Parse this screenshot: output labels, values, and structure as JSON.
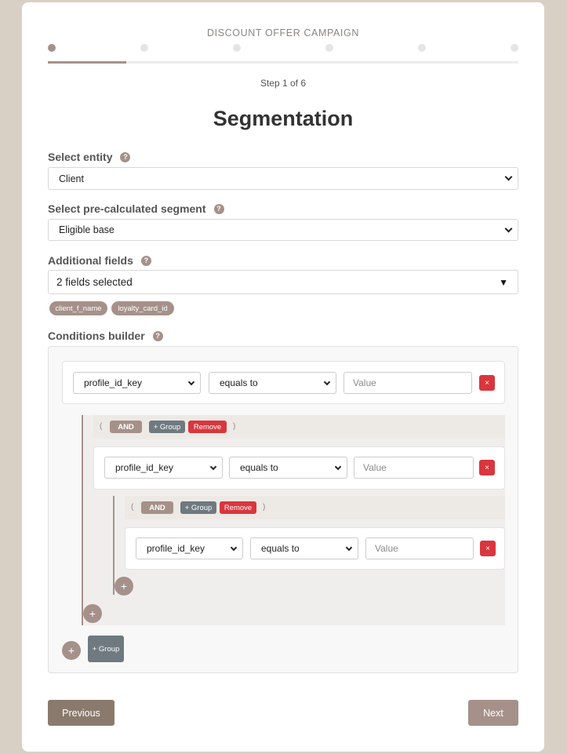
{
  "header": {
    "campaign_title": "DISCOUNT OFFER CAMPAIGN",
    "step_label": "Step 1 of 6",
    "page_title": "Segmentation",
    "progress": {
      "current_step": 1,
      "total_steps": 6
    }
  },
  "fields": {
    "entity": {
      "label": "Select entity",
      "help": "?",
      "value": "Client"
    },
    "segment": {
      "label": "Select pre-calculated segment",
      "help": "?",
      "value": "Eligible base"
    },
    "additional": {
      "label": "Additional fields",
      "help": "?",
      "value": "2 fields selected",
      "dropdown_glyph": "▼",
      "chips": [
        "client_f_name",
        "loyalty_card_id"
      ]
    }
  },
  "conditions": {
    "label": "Conditions builder",
    "help": "?",
    "rule": {
      "field": "profile_id_key",
      "operator": "equals to",
      "value_placeholder": "Value",
      "remove_glyph": "×"
    },
    "group": {
      "open_paren": "(",
      "close_paren": ")",
      "and_label": "AND",
      "add_group_label": "+ Group",
      "remove_label": "Remove"
    },
    "add_rule_glyph": "+",
    "add_group_label": "+ Group"
  },
  "nav": {
    "previous_label": "Previous",
    "next_label": "Next"
  },
  "colors": {
    "accent": "#a5918a",
    "danger": "#d9363e",
    "slate": "#6e7a80",
    "background": "#d9d0c5"
  }
}
